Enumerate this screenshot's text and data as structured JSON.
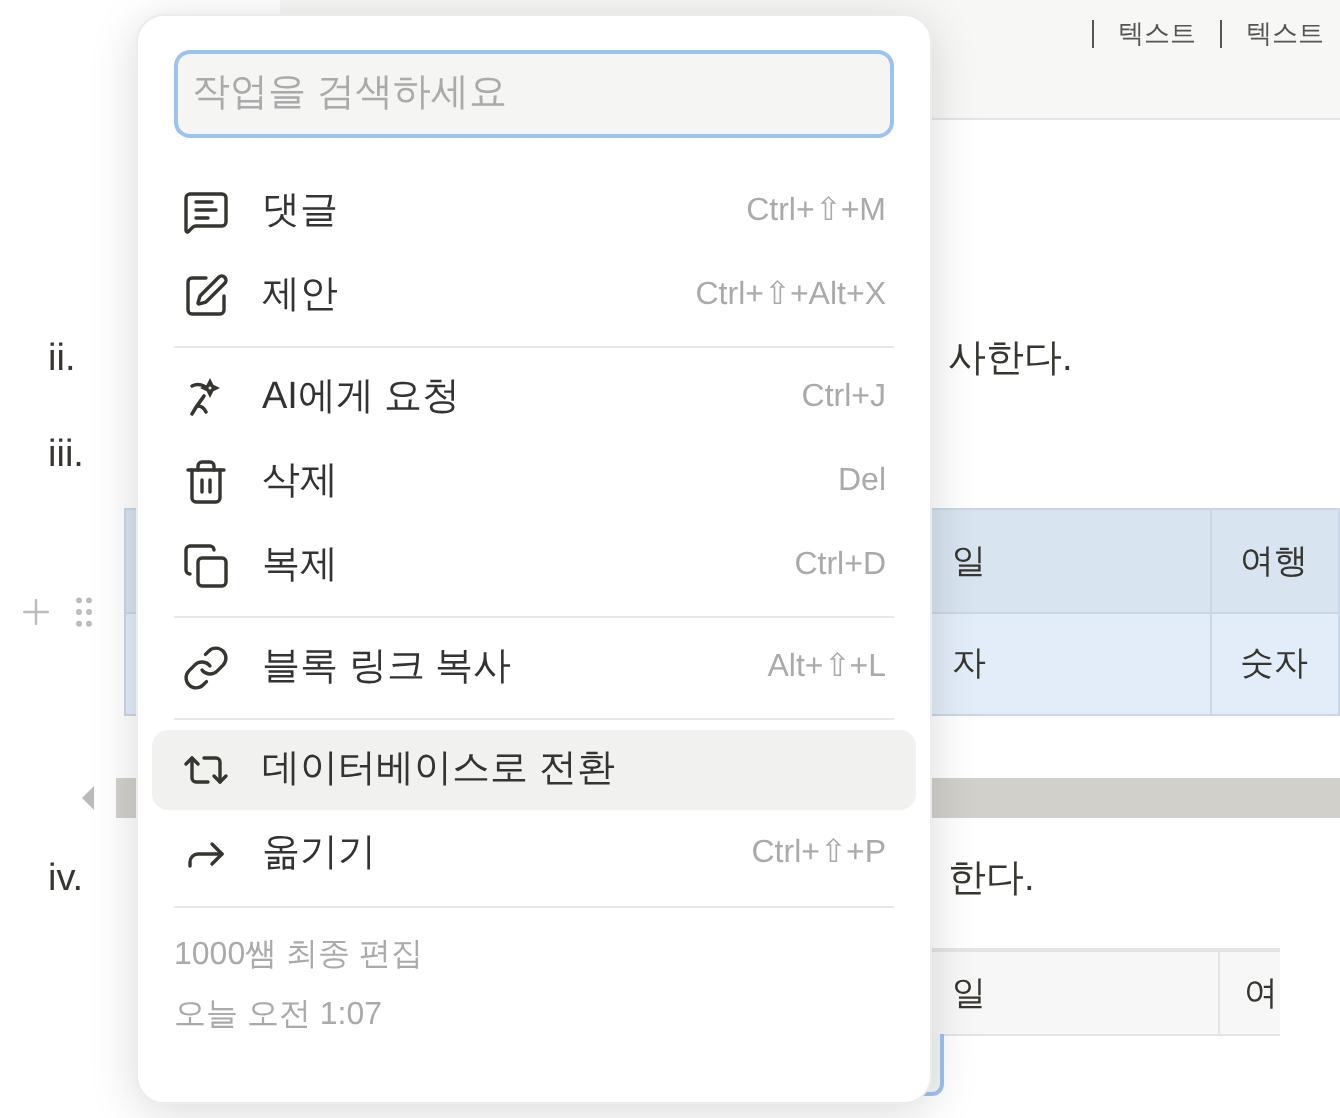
{
  "toolbar": {
    "items": [
      "텍스트",
      "텍스트"
    ]
  },
  "document": {
    "list_items": [
      {
        "marker": "ii.",
        "text": "사한다."
      },
      {
        "marker": "iii."
      }
    ],
    "table": {
      "header": [
        "일",
        "여행"
      ],
      "row": [
        "자",
        "숫자"
      ]
    },
    "list_items_after": [
      {
        "marker": "iv.",
        "text": "한다."
      }
    ],
    "table_2": {
      "header": [
        "일",
        "여"
      ]
    }
  },
  "menu": {
    "search": {
      "placeholder": "작업을 검색하세요"
    },
    "groups": [
      [
        {
          "kind": "comment",
          "label": "댓글",
          "shortcut": "Ctrl+⇧+M",
          "selected": false
        },
        {
          "kind": "suggest",
          "label": "제안",
          "shortcut": "Ctrl+⇧+Alt+X",
          "selected": false
        }
      ],
      [
        {
          "kind": "ai",
          "label": "AI에게 요청",
          "shortcut": "Ctrl+J",
          "selected": false
        },
        {
          "kind": "delete",
          "label": "삭제",
          "shortcut": "Del",
          "selected": false
        },
        {
          "kind": "duplicate",
          "label": "복제",
          "shortcut": "Ctrl+D",
          "selected": false
        }
      ],
      [
        {
          "kind": "link",
          "label": "블록 링크 복사",
          "shortcut": "Alt+⇧+L",
          "selected": false
        }
      ],
      [
        {
          "kind": "convert",
          "label": "데이터베이스로 전환",
          "selected": true
        },
        {
          "kind": "move",
          "label": "옮기기",
          "shortcut": "Ctrl+⇧+P",
          "selected": false
        }
      ]
    ],
    "footer": [
      "1000쌤 최종 편집",
      "오늘 오전 1:07"
    ]
  }
}
